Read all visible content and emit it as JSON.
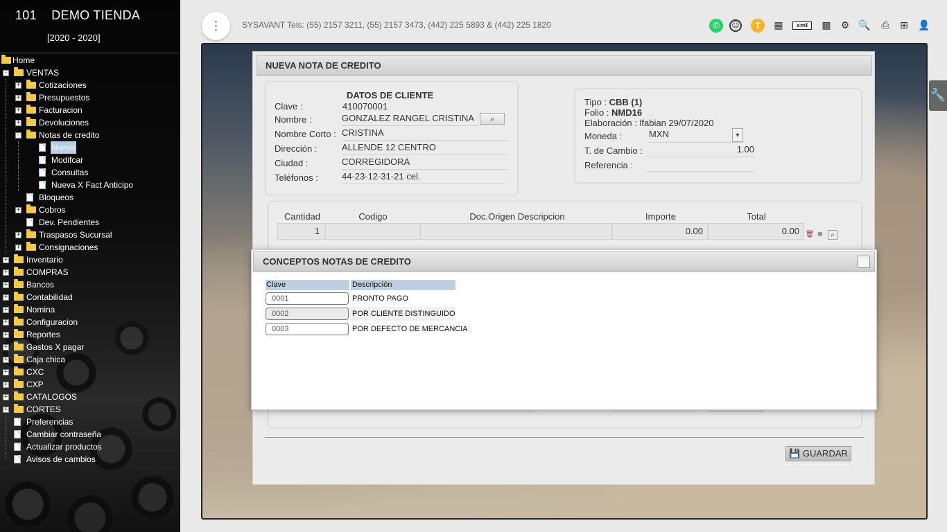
{
  "brand": {
    "number": "101",
    "name": "DEMO TIENDA",
    "years": "[2020 - 2020]"
  },
  "sidebar": {
    "home": "Home",
    "ventas": "VENTAS",
    "ventas_items": [
      "Cotizaciones",
      "Presupuestos",
      "Facturacion",
      "Devoluciones",
      "Notas de credito"
    ],
    "notas_items": [
      "Nueva",
      "Modifcar",
      "Consultas",
      "Nueva X Fact Anticipo"
    ],
    "ventas_items2": [
      "Bloqueos",
      "Cobros",
      "Dev. Pendientes",
      "Traspasos Sucursal",
      "Consignaciones"
    ],
    "modules": [
      "Inventario",
      "COMPRAS",
      "Bancos",
      "Contabilidad",
      "Nomina",
      "Configuracion",
      "Reportes",
      "Gastos X pagar",
      "Caja chica",
      "CXC",
      "CXP",
      "CATALOGOS",
      "CORTES"
    ],
    "docs": [
      "Preferencias",
      "Cambiar contraseña",
      "Actualizar productos",
      "Avisos de cambios"
    ]
  },
  "topbar": {
    "contact": "SYSAVANT Tels: (55) 2157 3211, (55) 2157 3473, (442) 225 5893 & (442) 225 1820",
    "icons": [
      "whatsapp-icon",
      "assistant-icon",
      "t-badge-icon",
      "dashboard-icon",
      "xml-icon",
      "qr-icon",
      "settings-icon",
      "search-doc-icon",
      "print-icon",
      "new-window-icon",
      "user-icon"
    ],
    "t_badge": "T",
    "xml_label": "xml"
  },
  "panel": {
    "title": "NUEVA NOTA DE CREDITO",
    "client": {
      "heading": "DATOS DE CLIENTE",
      "clave_label": "Clave :",
      "clave": "410070001",
      "nombre_label": "Nombre :",
      "nombre": "GONZALEZ RANGEL CRISTINA",
      "corto_label": "Nombre Corto :",
      "corto": "CRISTINA",
      "direccion_label": "Dirección :",
      "direccion": "ALLENDE 12 CENTRO",
      "ciudad_label": "Ciudad :",
      "ciudad": "CORREGIDORA",
      "telefonos_label": "Teléfonos :",
      "telefonos": "44-23-12-31-21 cel."
    },
    "doc": {
      "tipo_label": "Tipo :",
      "tipo": "CBB (1)",
      "folio_label": "Folio :",
      "folio": "NMD16",
      "elab_label": "Elaboración :",
      "elab": "lfabian 29/07/2020",
      "moneda_label": "Moneda :",
      "moneda": "MXN",
      "cambio_label": "T. de Cambio :",
      "cambio": "1.00",
      "ref_label": "Referencia :",
      "ref": ""
    },
    "items": {
      "headers": [
        "Cantidad",
        "Codigo",
        "Doc.Origen Descripcion",
        "Importe",
        "Total"
      ],
      "row": {
        "cantidad": "1",
        "codigo": "",
        "descripcion": "",
        "importe": "0.00",
        "total": "0.00"
      }
    },
    "save_label": "GUARDAR"
  },
  "modal": {
    "title": "CONCEPTOS NOTAS DE CREDITO",
    "headers": {
      "clave": "Clave",
      "descripcion": "Descripción"
    },
    "rows": [
      {
        "clave": "0001",
        "descripcion": "PRONTO PAGO"
      },
      {
        "clave": "0002",
        "descripcion": "POR CLIENTE DISTINGUIDO"
      },
      {
        "clave": "0003",
        "descripcion": "POR DEFECTO DE MERCANCIA"
      }
    ]
  }
}
